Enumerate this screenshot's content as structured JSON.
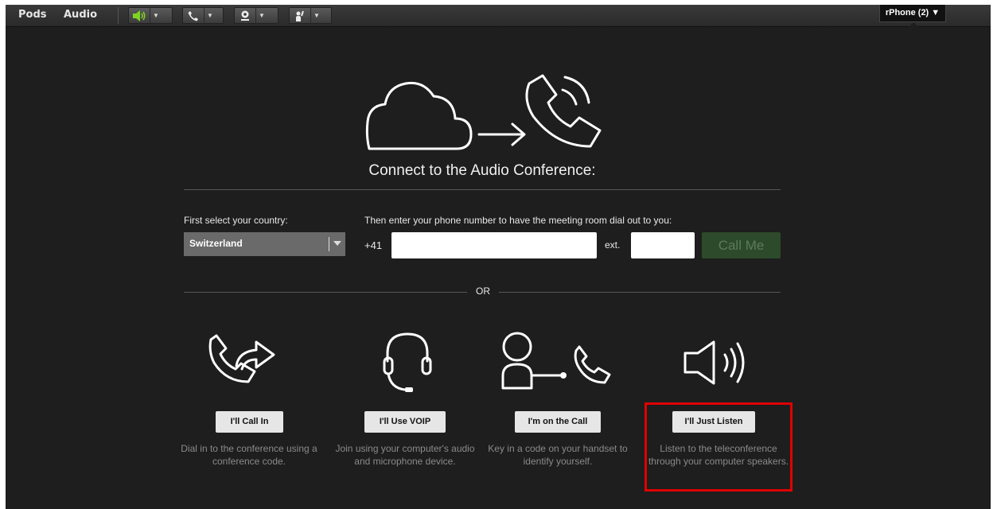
{
  "menu": {
    "pods": "Pods",
    "audio": "Audio"
  },
  "toolbar": {
    "speaker_color": "#7ed321"
  },
  "account": {
    "label": "rPhone (2) ▼"
  },
  "dialog": {
    "title": "Connect to the Audio Conference:",
    "country_label": "First select your country:",
    "country_value": "Switzerland",
    "phone_label": "Then enter your phone number to have the meeting room dial out to you:",
    "country_code": "+41",
    "phone_value": "",
    "ext_label": "ext.",
    "ext_value": "",
    "call_me": "Call Me",
    "or": "OR"
  },
  "options": [
    {
      "button": "I'll Call In",
      "desc": "Dial in to the conference using a conference code."
    },
    {
      "button": "I'll Use VOIP",
      "desc": "Join using your computer's audio and microphone device."
    },
    {
      "button": "I'm on the Call",
      "desc": "Key in a code on your handset to identify yourself."
    },
    {
      "button": "I'll Just Listen",
      "desc": "Listen to the teleconference through your computer speakers."
    }
  ]
}
